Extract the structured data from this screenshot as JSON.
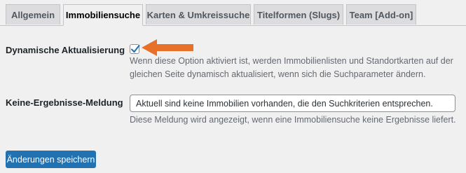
{
  "tabs": [
    {
      "label": "Allgemein",
      "active": false
    },
    {
      "label": "Immobiliensuche",
      "active": true
    },
    {
      "label": "Karten & Umkreissuche",
      "active": false
    },
    {
      "label": "Titelformen (Slugs)",
      "active": false
    },
    {
      "label": "Team [Add-on]",
      "active": false
    }
  ],
  "dynamic_update": {
    "label": "Dynamische Aktualisierung",
    "checked": true,
    "description_line1": "Wenn diese Option aktiviert ist, werden Immobilienlisten und Standortkarten auf der",
    "description_line2": "gleichen Seite dynamisch aktualisiert, wenn sich die Suchparameter ändern."
  },
  "no_results": {
    "label": "Keine-Ergebnisse-Meldung",
    "value": "Aktuell sind keine Immobilien vorhanden, die den Suchkriterien entsprechen.",
    "description": "Diese Meldung wird angezeigt, wenn eine Immobiliensuche keine Ergebnisse liefert."
  },
  "save_button": {
    "label": "Änderungen speichern"
  },
  "colors": {
    "primary": "#2271b1",
    "arrow": "#e8712a",
    "background": "#f0f0f1",
    "checkmark": "#2271b1"
  },
  "icons": {
    "checkmark": "checkmark-icon",
    "arrow": "arrow-left-icon"
  }
}
